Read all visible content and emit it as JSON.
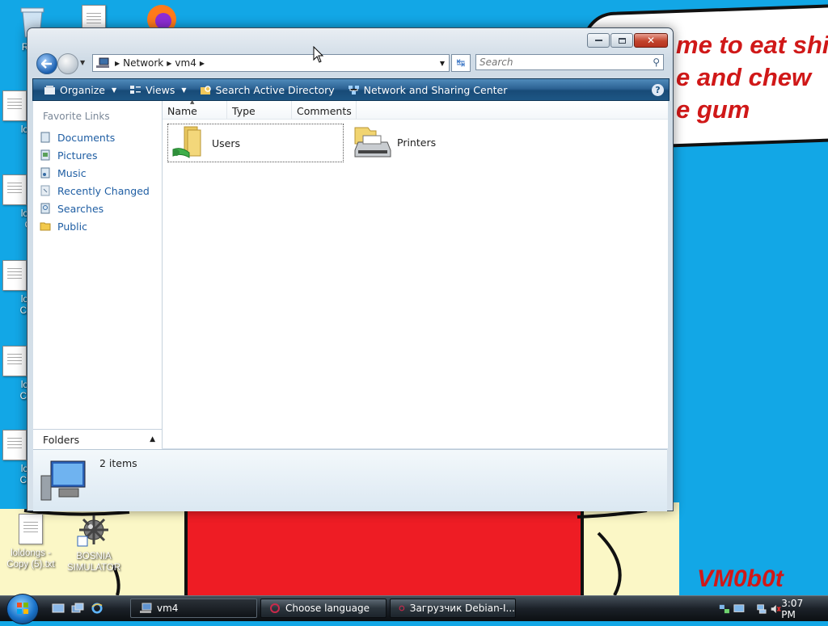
{
  "wallpaper": {
    "bubble_lines": [
      "me to eat shit",
      "e and chew",
      "e gum"
    ],
    "signature": "VM0b0t"
  },
  "desktop": {
    "icons": [
      {
        "label": "Recy"
      },
      {
        "label": "loldo"
      },
      {
        "label": "loldo Co"
      },
      {
        "label": "loldo Copy"
      },
      {
        "label": "loldo Copy"
      },
      {
        "label": "loldo Copy"
      },
      {
        "label": "loldongs - Copy (5).txt"
      },
      {
        "label": "BOSNIA SIMULATOR"
      }
    ]
  },
  "window": {
    "breadcrumb": [
      "Network",
      "vm4"
    ],
    "search_placeholder": "Search",
    "toolbar": {
      "organize": "Organize",
      "views": "Views",
      "search_ad": "Search Active Directory",
      "network_sharing": "Network and Sharing Center",
      "help": "?"
    },
    "nav": {
      "header": "Favorite Links",
      "links": [
        "Documents",
        "Pictures",
        "Music",
        "Recently Changed",
        "Searches",
        "Public"
      ],
      "folders": "Folders"
    },
    "columns": [
      "Name",
      "Type",
      "Comments"
    ],
    "items": [
      {
        "name": "Users",
        "icon": "shared-folder-icon"
      },
      {
        "name": "Printers",
        "icon": "printers-folder-icon"
      }
    ],
    "details": {
      "count": "2 items"
    }
  },
  "taskbar": {
    "buttons": [
      "vm4",
      "Choose language",
      "Загрузчик Debian-I..."
    ],
    "clock": "3:07 PM"
  }
}
